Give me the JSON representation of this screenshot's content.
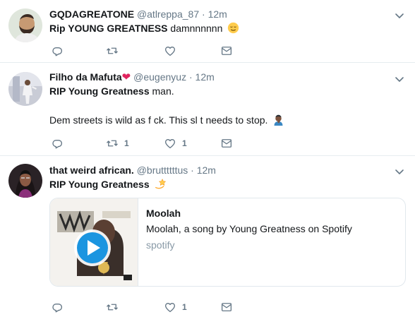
{
  "tweets": [
    {
      "name": "GQDAGREATONE",
      "handle": "@atlreppa_87",
      "dot": "·",
      "time": "12m",
      "text_bold": "Rip YOUNG GREATNESS",
      "text_rest": " damnnnnnn",
      "emoji": "relieved-face",
      "actions": {
        "reply": "",
        "retweet": "",
        "like": "",
        "dm": ""
      }
    },
    {
      "name": "Filho da Mafuta",
      "name_emoji": "❤",
      "handle": "@eugenyuz",
      "dot": "·",
      "time": "12m",
      "text_bold": "RIP Young Greatness",
      "text_rest": " man.",
      "line2": "Dem streets is wild as f  ck. This sl  t needs to stop.",
      "emoji": "person-facepalming",
      "actions": {
        "reply": "",
        "retweet": "1",
        "like": "1",
        "dm": ""
      }
    },
    {
      "name": "that weird african.",
      "handle": "@bruttttttus",
      "dot": "·",
      "time": "12m",
      "text_bold": "RIP Young Greatness",
      "text_rest": "",
      "emoji": "dizzy-star",
      "card": {
        "title": "Moolah",
        "description": "Moolah, a song by Young Greatness on Spotify",
        "domain": "spotify"
      },
      "actions": {
        "reply": "",
        "retweet": "",
        "like": "1",
        "dm": ""
      }
    }
  ],
  "colors": {
    "text": "#14171a",
    "muted": "#657786",
    "border": "#e6ecf0",
    "heart": "#e0245e",
    "play": "#1b95e0"
  }
}
